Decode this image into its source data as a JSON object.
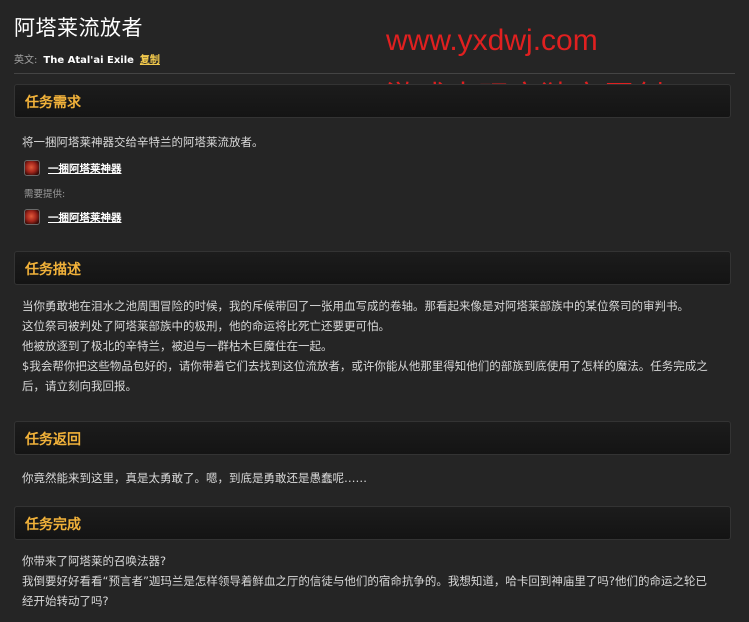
{
  "quest": {
    "title": "阿塔莱流放者",
    "english_label": "英文:",
    "english_name": "The Atal'ai Exile",
    "copy_label": "复制"
  },
  "watermark": {
    "url": "www.yxdwj.com",
    "tagline": "游戏大玩家独家原创"
  },
  "sections": {
    "requirements": {
      "heading": "任务需求",
      "text": "将一捆阿塔莱神器交给辛特兰的阿塔莱流放者。",
      "item": "一捆阿塔莱神器",
      "provided_label": "需要提供:",
      "provided_item": "一捆阿塔莱神器"
    },
    "description": {
      "heading": "任务描述",
      "lines": [
        "当你勇敢地在泪水之池周围冒险的时候，我的斥候带回了一张用血写成的卷轴。那看起来像是对阿塔莱部族中的某位祭司的审判书。",
        "这位祭司被判处了阿塔莱部族中的极刑，他的命运将比死亡还要更可怕。",
        "他被放逐到了极北的辛特兰，被迫与一群枯木巨魔住在一起。",
        "$我会帮你把这些物品包好的，请你带着它们去找到这位流放者，或许你能从他那里得知他们的部族到底使用了怎样的魔法。任务完成之",
        "后，请立刻向我回报。"
      ]
    },
    "return": {
      "heading": "任务返回",
      "text": "你竟然能来到这里，真是太勇敢了。嗯，到底是勇敢还是愚蠢呢……"
    },
    "complete": {
      "heading": "任务完成",
      "lines": [
        "你带来了阿塔莱的召唤法器?",
        "我倒要好好看看“预言者”迦玛兰是怎样领导着鲜血之厅的信徒与他们的宿命抗争的。我想知道，哈卡回到神庙里了吗?他们的命运之轮已",
        "经开始转动了吗?"
      ]
    }
  },
  "colors": {
    "background": "#252525",
    "heading": "#f2b23a",
    "link": "#f2c94c",
    "watermark": "#e02020"
  }
}
